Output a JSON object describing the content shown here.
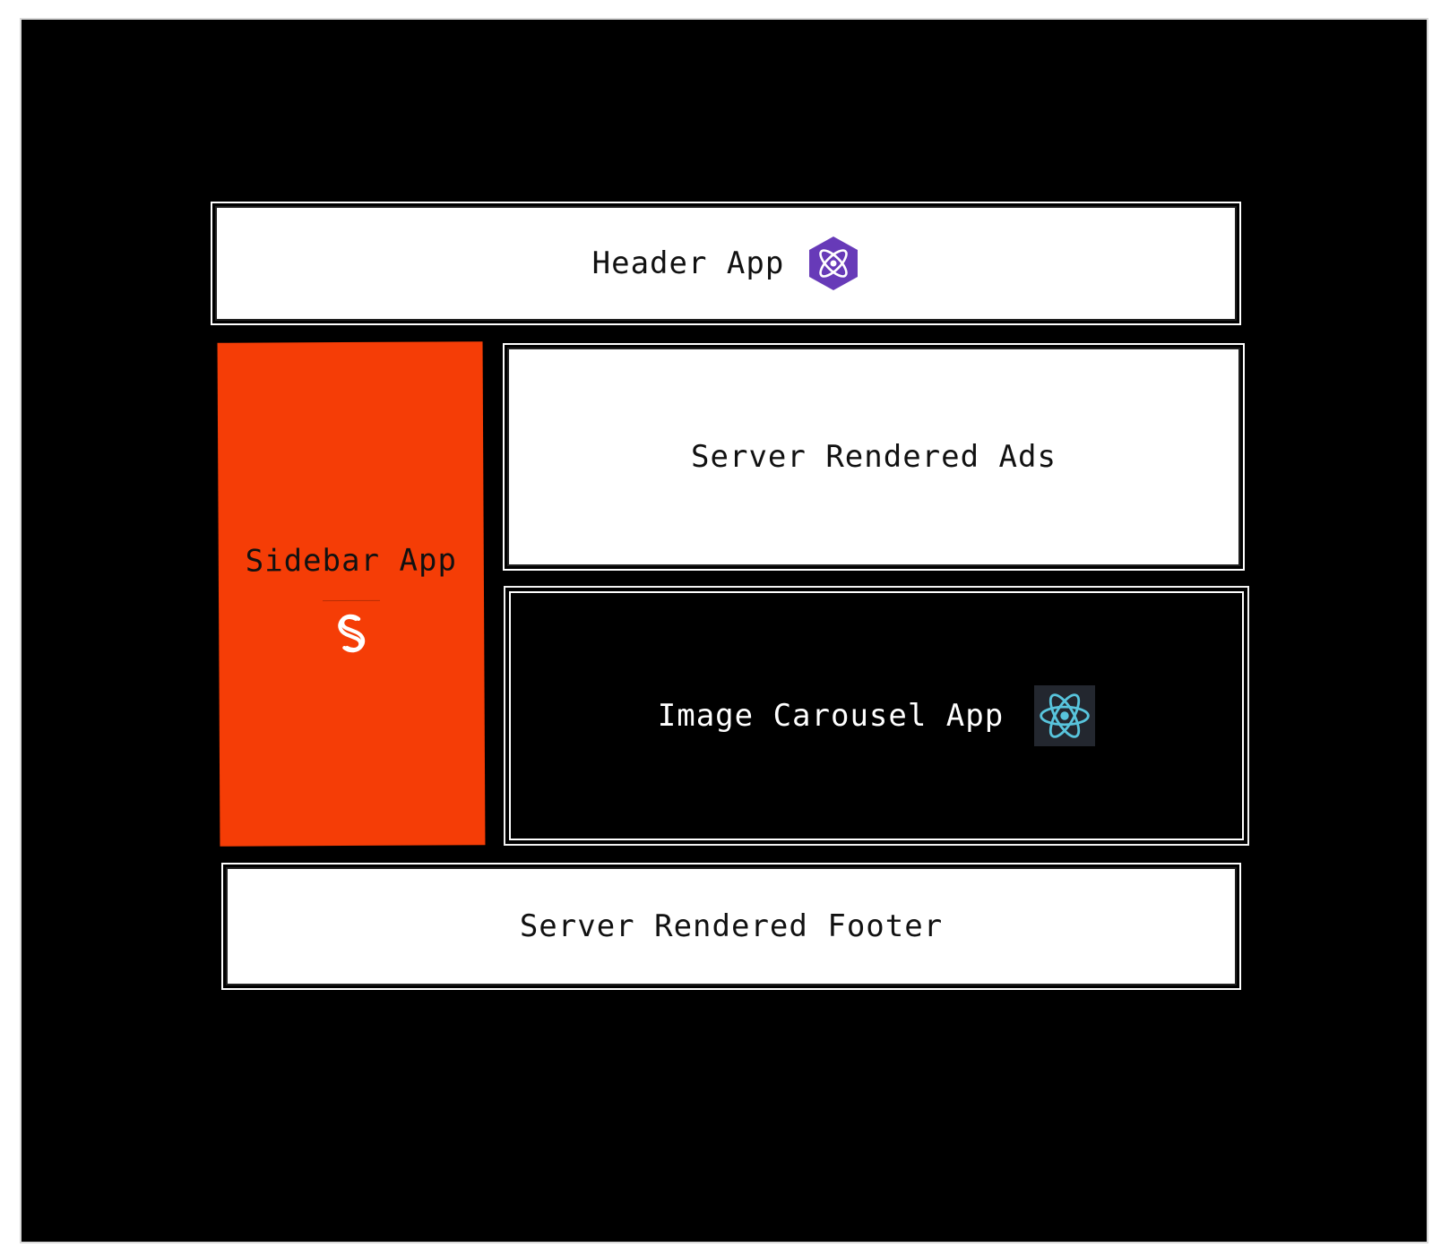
{
  "diagram": {
    "header": {
      "label": "Header App",
      "icon": "preact-icon"
    },
    "sidebar": {
      "label": "Sidebar App",
      "icon": "svelte-icon",
      "color": "#f53d06"
    },
    "ads": {
      "label": "Server Rendered Ads"
    },
    "carousel": {
      "label": "Image Carousel App",
      "icon": "react-icon"
    },
    "footer": {
      "label": "Server Rendered Footer"
    },
    "colors": {
      "frame": "#000000",
      "panel": "#ffffff",
      "sidebar": "#f53d06",
      "preact": "#673ab8",
      "react": "#58c4dc",
      "react_bg": "#23272f"
    }
  }
}
